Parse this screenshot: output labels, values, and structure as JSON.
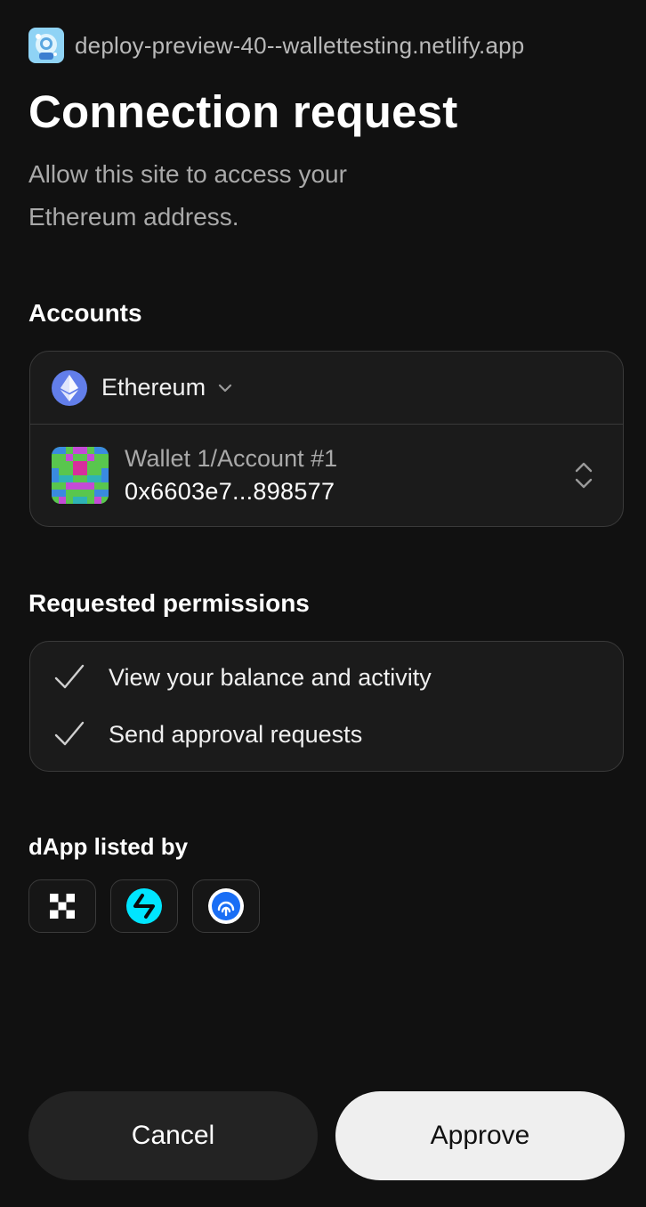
{
  "site": {
    "favicon": "globe-avatar-icon",
    "url": "deploy-preview-40--wallettesting.netlify.app"
  },
  "title": "Connection request",
  "subtitle": "Allow this site to access your Ethereum address.",
  "accounts": {
    "label": "Accounts",
    "network": {
      "name": "Ethereum",
      "icon": "ethereum-icon",
      "color": "#627eea"
    },
    "account": {
      "name": "Wallet 1/Account #1",
      "address": "0x6603e7...898577"
    }
  },
  "permissions": {
    "label": "Requested permissions",
    "items": [
      {
        "label": "View your balance and activity",
        "icon": "check-icon"
      },
      {
        "label": "Send approval requests",
        "icon": "check-icon"
      }
    ]
  },
  "listed_by": {
    "label": "dApp listed by",
    "items": [
      {
        "name": "okx-logo-icon"
      },
      {
        "name": "bitget-logo-icon"
      },
      {
        "name": "fingerprint-logo-icon"
      }
    ]
  },
  "buttons": {
    "cancel": "Cancel",
    "approve": "Approve"
  },
  "colors": {
    "background": "#111111",
    "card": "#1b1b1b",
    "border": "#3a3a3a",
    "approve_bg": "#efefef",
    "cancel_bg": "#232323"
  }
}
